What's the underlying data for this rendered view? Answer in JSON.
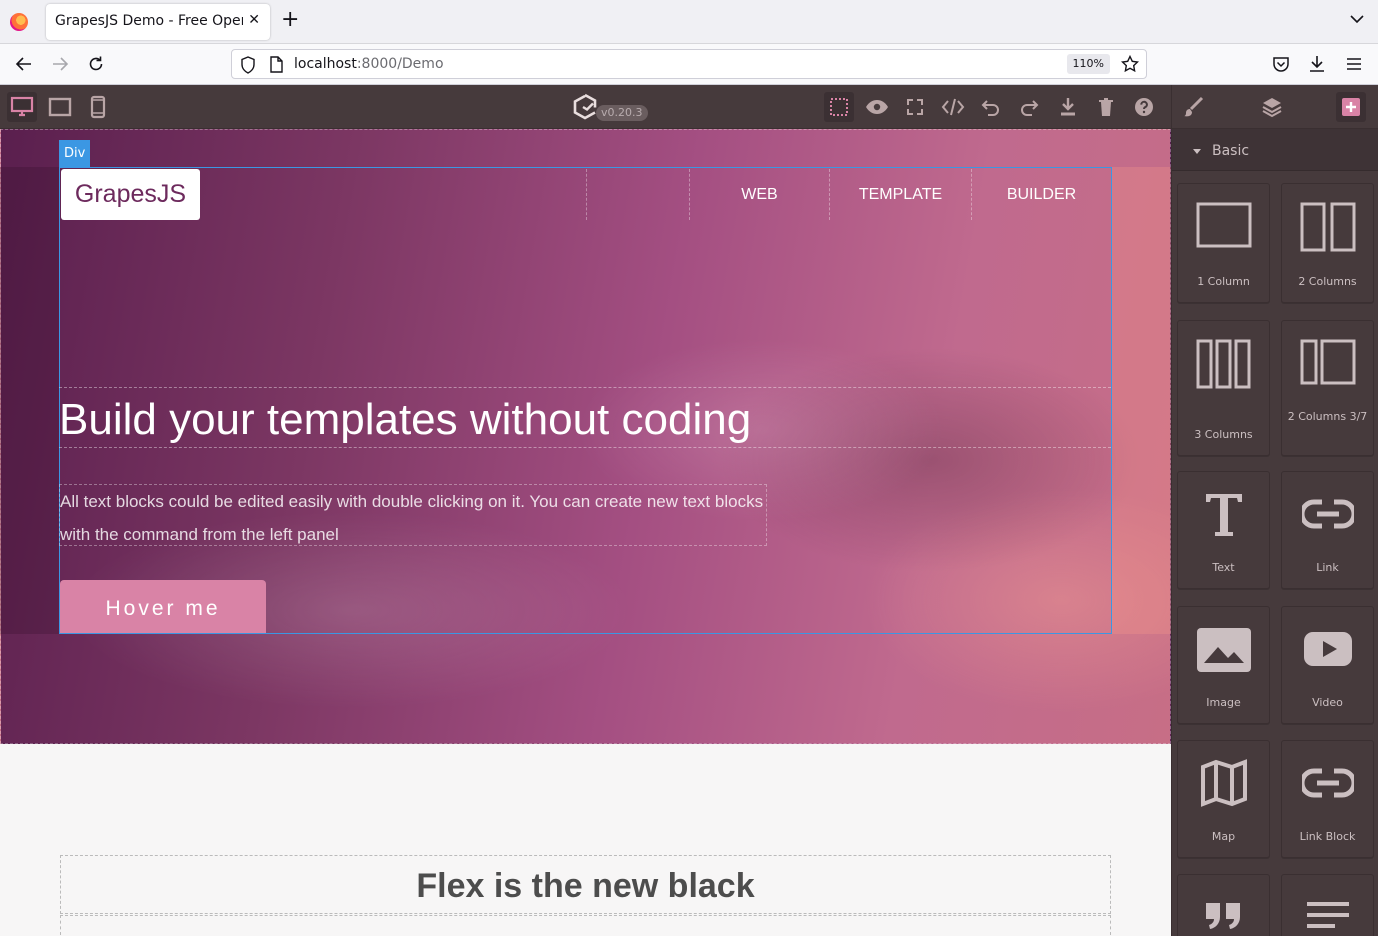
{
  "browser": {
    "tab_title": "GrapesJS Demo - Free Open",
    "new_tab": "+",
    "url_host": "localhost",
    "url_path": ":8000/Demo",
    "zoom": "110%"
  },
  "editor": {
    "version": "v0.20.3",
    "devices": [
      "desktop-icon",
      "tablet-icon",
      "mobile-icon"
    ],
    "options": [
      "sw-visibility-icon",
      "preview-icon",
      "fullscreen-icon",
      "export-code-icon",
      "undo-icon",
      "redo-icon",
      "import-icon",
      "trash-icon",
      "help-icon"
    ],
    "views": [
      "style-manager-icon",
      "layer-manager-icon",
      "blocks-icon"
    ],
    "accent": "#d983a6"
  },
  "canvas": {
    "selected_badge": "Div",
    "brand": "GrapesJS",
    "nav": [
      "WEB",
      "TEMPLATE",
      "BUILDER"
    ],
    "hero_title": "Build your templates without coding",
    "hero_text": "All text blocks could be edited easily with double clicking on it. You can create new text blocks with the command from the left panel",
    "hero_button": "Hover me",
    "section_title": "Flex is the new black"
  },
  "blocks": {
    "category": "Basic",
    "items": [
      {
        "label": "1 Column",
        "icon": "column-1-icon"
      },
      {
        "label": "2 Columns",
        "icon": "columns-2-icon"
      },
      {
        "label": "3 Columns",
        "icon": "columns-3-icon"
      },
      {
        "label": "2 Columns 3/7",
        "icon": "columns-37-icon"
      },
      {
        "label": "Text",
        "icon": "text-icon"
      },
      {
        "label": "Link",
        "icon": "link-icon"
      },
      {
        "label": "Image",
        "icon": "image-icon"
      },
      {
        "label": "Video",
        "icon": "video-icon"
      },
      {
        "label": "Map",
        "icon": "map-icon"
      },
      {
        "label": "Link Block",
        "icon": "link-block-icon"
      },
      {
        "label": "",
        "icon": "quote-icon"
      },
      {
        "label": "",
        "icon": "text-section-icon"
      }
    ]
  }
}
